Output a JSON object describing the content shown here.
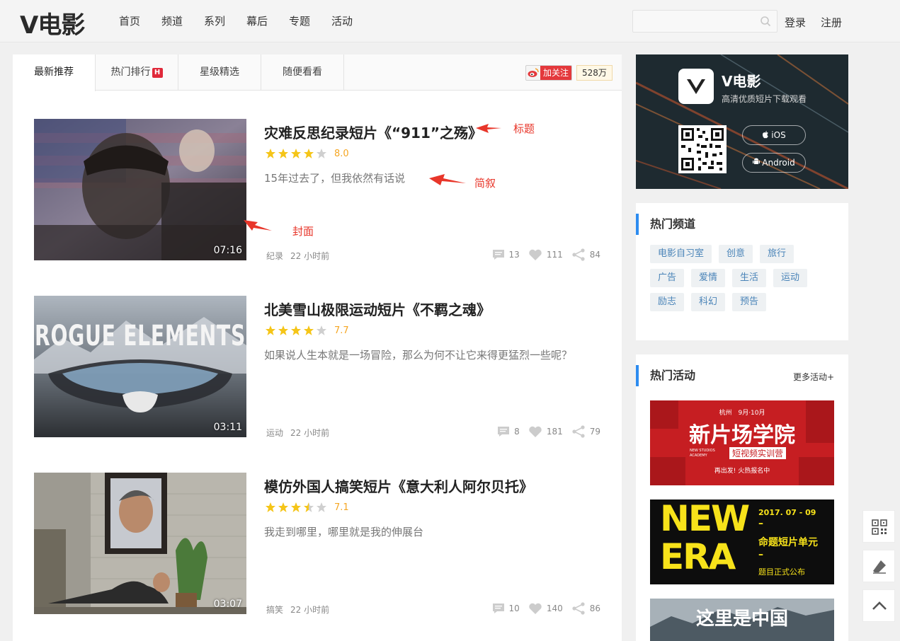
{
  "header": {
    "logo": "V电影",
    "nav": [
      "首页",
      "频道",
      "系列",
      "幕后",
      "专题",
      "活动"
    ],
    "search_placeholder": "",
    "login": "登录",
    "register": "注册"
  },
  "tabs": [
    {
      "label": "最新推荐",
      "active": true
    },
    {
      "label": "热门排行",
      "badge": "H"
    },
    {
      "label": "星级精选"
    },
    {
      "label": "随便看看"
    }
  ],
  "weibo": {
    "follow_label": "加关注",
    "count": "528万"
  },
  "videos": [
    {
      "title": "灾难反思纪录短片《“911”之殇》",
      "rating": 4,
      "score": "8.0",
      "desc": "15年过去了，但我依然有话说",
      "duration": "07:16",
      "category": "纪录",
      "time": "22 小时前",
      "comments": "13",
      "likes": "111",
      "shares": "84"
    },
    {
      "title": "北美雪山极限运动短片《不羁之魂》",
      "rating": 4,
      "score": "7.7",
      "desc": "如果说人生本就是一场冒险，那么为何不让它来得更猛烈一些呢？",
      "duration": "03:11",
      "category": "运动",
      "time": "22 小时前",
      "comments": "8",
      "likes": "181",
      "shares": "79",
      "cover_text": "ROGUE ELEMENTS"
    },
    {
      "title": "模仿外国人搞笑短片《意大利人阿尔贝托》",
      "rating": 3.5,
      "score": "7.1",
      "desc": "我走到哪里，哪里就是我的伸展台",
      "duration": "03:07",
      "category": "搞笑",
      "time": "22 小时前",
      "comments": "10",
      "likes": "140",
      "shares": "86"
    }
  ],
  "annotations": {
    "title": "标题",
    "desc": "简叙",
    "cover": "封面"
  },
  "app_promo": {
    "name": "V电影",
    "tagline": "高清优质短片下载观看",
    "ios_label": "iOS",
    "android_label": "Android"
  },
  "hot_channels": {
    "title": "热门频道",
    "tags": [
      "电影自习室",
      "创意",
      "旅行",
      "广告",
      "爱情",
      "生活",
      "运动",
      "励志",
      "科幻",
      "预告"
    ]
  },
  "hot_activities": {
    "title": "热门活动",
    "more": "更多活动+",
    "banners": [
      {
        "top_line": "杭州　9月·10月",
        "headline": "新片场学院",
        "sub_en": "NEW STUDIOS ACADEMY",
        "sub": "短视频实训营",
        "foot": "再出发!  火热报名中"
      },
      {
        "big1": "NEW",
        "big2": "ERA",
        "date": "2017. 07 - 09",
        "dash": "–",
        "line1": "命题短片单元",
        "line2": "题目正式公布"
      },
      {
        "headline": "这里是中国"
      }
    ]
  },
  "colors": {
    "accent_blue": "#2d8cf0",
    "star": "#f5c518",
    "score": "#f5a623",
    "weibo_red": "#e4393c",
    "annotation_red": "#e8362a"
  }
}
